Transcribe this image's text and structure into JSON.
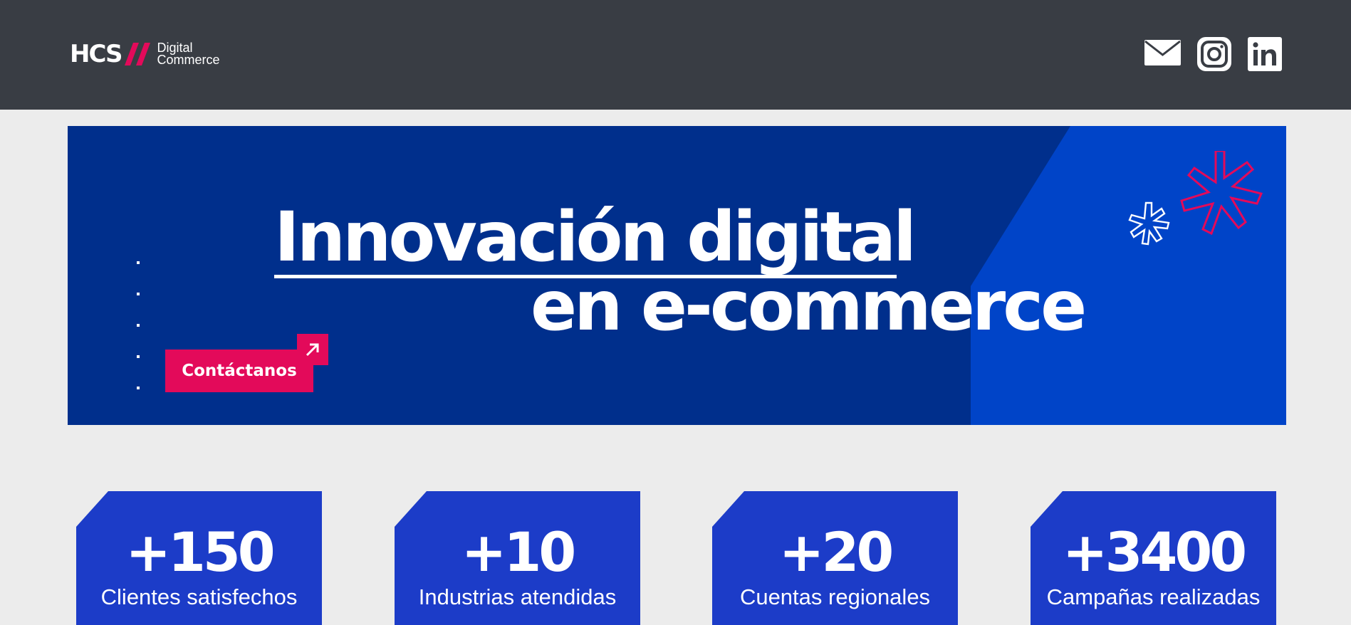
{
  "header": {
    "logo": {
      "mark": "HCS",
      "line1": "Digital",
      "line2": "Commerce"
    },
    "social": [
      {
        "name": "mail-icon"
      },
      {
        "name": "instagram-icon"
      },
      {
        "name": "linkedin-icon"
      }
    ],
    "bg_color": "#393d44"
  },
  "hero": {
    "line1": "Innovación digital",
    "line2": "en e-commerce",
    "cta_label": "Contáctanos",
    "bg_color": "#002f8c",
    "accent_color": "#e30a5a"
  },
  "stats": [
    {
      "value": "+150",
      "label": "Clientes satisfechos"
    },
    {
      "value": "+10",
      "label": "Industrias atendidas"
    },
    {
      "value": "+20",
      "label": "Cuentas regionales"
    },
    {
      "value": "+3400",
      "label": "Campañas realizadas"
    }
  ]
}
